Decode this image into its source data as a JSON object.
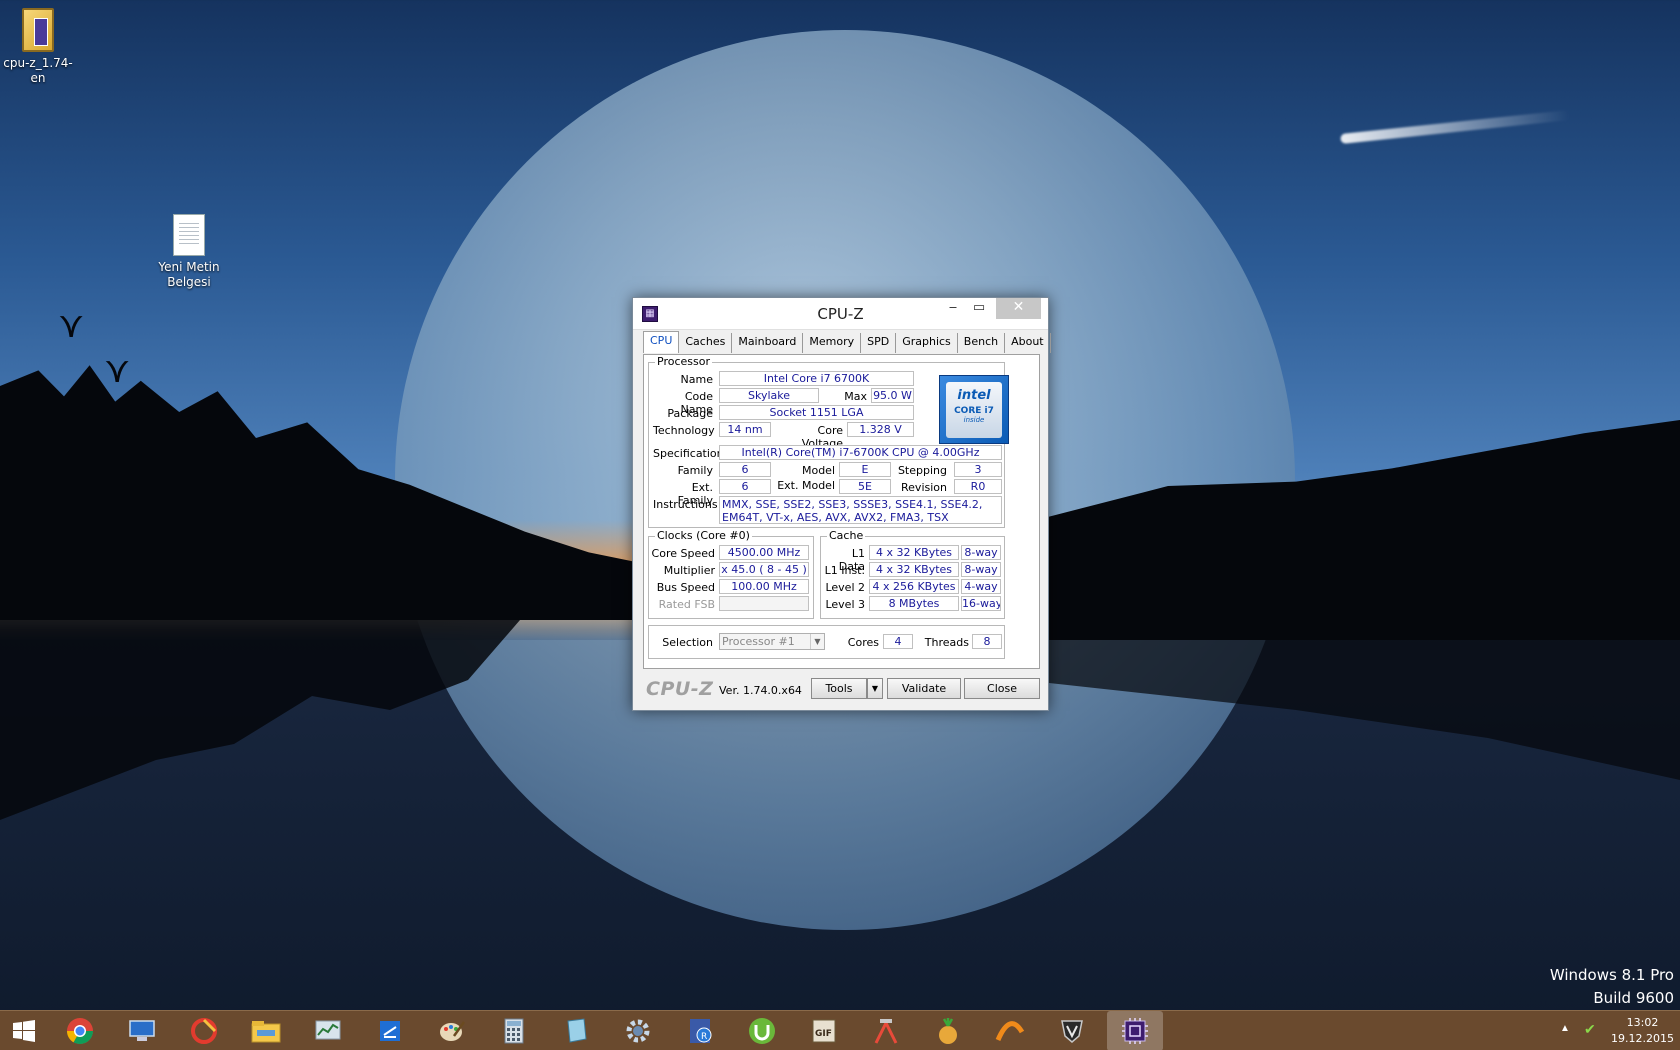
{
  "desktop": {
    "icons": [
      {
        "label": "cpu-z_1.74-en"
      },
      {
        "label": "Yeni Metin Belgesi"
      }
    ],
    "watermark": {
      "line1": "Windows 8.1 Pro",
      "line2": "Build 9600"
    }
  },
  "window": {
    "title": "CPU-Z",
    "controls": {
      "minimize": "‒",
      "maximize": "▭",
      "close": "✕"
    },
    "tabs": [
      "CPU",
      "Caches",
      "Mainboard",
      "Memory",
      "SPD",
      "Graphics",
      "Bench",
      "About"
    ],
    "processor": {
      "group_title": "Processor",
      "name_label": "Name",
      "name": "Intel Core i7 6700K",
      "codename_label": "Code Name",
      "codename": "Skylake",
      "maxtdp_label": "Max TDP",
      "maxtdp": "95.0 W",
      "package_label": "Package",
      "package": "Socket 1151 LGA",
      "technology_label": "Technology",
      "technology": "14 nm",
      "corevoltage_label": "Core Voltage",
      "corevoltage": "1.328 V",
      "spec_label": "Specification",
      "spec": "Intel(R) Core(TM) i7-6700K CPU @ 4.00GHz",
      "family_label": "Family",
      "family": "6",
      "model_label": "Model",
      "model": "E",
      "stepping_label": "Stepping",
      "stepping": "3",
      "extfamily_label": "Ext. Family",
      "extfamily": "6",
      "extmodel_label": "Ext. Model",
      "extmodel": "5E",
      "revision_label": "Revision",
      "revision": "R0",
      "instructions_label": "Instructions",
      "instructions": "MMX, SSE, SSE2, SSE3, SSSE3, SSE4.1, SSE4.2, EM64T, VT-x, AES, AVX, AVX2, FMA3, TSX",
      "logo": {
        "word": "intel",
        "core": "CORE i7",
        "inside": "inside"
      }
    },
    "clocks": {
      "group_title": "Clocks (Core #0)",
      "corespeed_label": "Core Speed",
      "corespeed": "4500.00 MHz",
      "multiplier_label": "Multiplier",
      "multiplier": "x 45.0 ( 8 - 45 )",
      "busspeed_label": "Bus Speed",
      "busspeed": "100.00 MHz",
      "ratedfsb_label": "Rated FSB",
      "ratedfsb": ""
    },
    "cache": {
      "group_title": "Cache",
      "rows": [
        {
          "label": "L1 Data",
          "size": "4 x 32 KBytes",
          "way": "8-way"
        },
        {
          "label": "L1 Inst.",
          "size": "4 x 32 KBytes",
          "way": "8-way"
        },
        {
          "label": "Level 2",
          "size": "4 x 256 KBytes",
          "way": "4-way"
        },
        {
          "label": "Level 3",
          "size": "8 MBytes",
          "way": "16-way"
        }
      ]
    },
    "selection": {
      "label": "Selection",
      "value": "Processor #1",
      "cores_label": "Cores",
      "cores": "4",
      "threads_label": "Threads",
      "threads": "8"
    },
    "footer": {
      "brand": "CPU-Z",
      "version": "Ver. 1.74.0.x64",
      "tools": "Tools",
      "validate": "Validate",
      "close": "Close"
    }
  },
  "taskbar": {
    "items": [
      "start-icon",
      "chrome-icon",
      "remote-desktop-icon",
      "ccleaner-icon",
      "file-explorer-icon",
      "resource-monitor-icon",
      "snipping-tool-icon",
      "paint-icon",
      "calculator-icon",
      "notepad-icon",
      "settings-icon",
      "winrar-icon",
      "utorrent-icon",
      "gif-tool-icon",
      "tools-icon",
      "game-icon",
      "arc-icon",
      "world-of-tanks-icon",
      "cpu-z-icon"
    ],
    "clock": {
      "time": "13:02",
      "date": "19.12.2015"
    }
  }
}
